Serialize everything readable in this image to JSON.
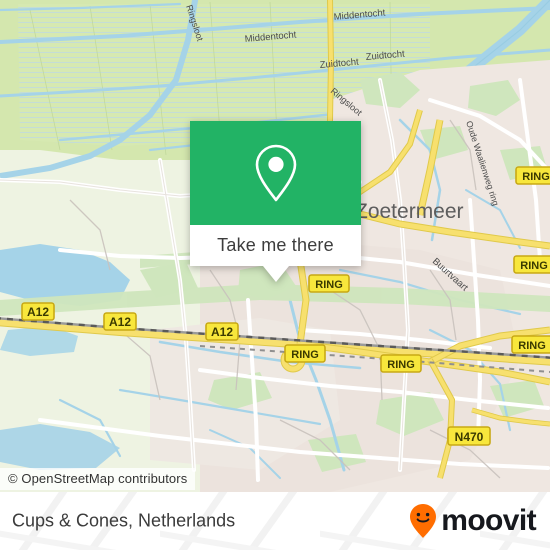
{
  "map": {
    "attribution": "© OpenStreetMap contributors",
    "city_label": "Zoetermeer",
    "water_labels": [
      {
        "name": "Middentocht"
      },
      {
        "name": "Middentocht"
      },
      {
        "name": "Zuidtocht"
      },
      {
        "name": "Zuidtocht"
      },
      {
        "name": "Ringsloot"
      },
      {
        "name": "Ringsloot"
      },
      {
        "name": "Buurtvaart"
      }
    ],
    "street_label": "Oude Waalienweg ring",
    "road_shields": [
      {
        "label": "A12"
      },
      {
        "label": "A12"
      },
      {
        "label": "A12"
      },
      {
        "label": "RING"
      },
      {
        "label": "RING"
      },
      {
        "label": "RING"
      },
      {
        "label": "RING"
      },
      {
        "label": "RING"
      },
      {
        "label": "RING"
      },
      {
        "label": "N470"
      }
    ],
    "colors": {
      "farmland": "#cfe3a8",
      "meadow": "#d6e8b0",
      "residential": "#ece3dd",
      "park": "#c9e4bb",
      "water": "#a5d3e8",
      "road_major": "#f7e06e",
      "road_minor": "#ffffff",
      "shield_fill": "#f8e73c",
      "shield_border": "#c8a915",
      "shield_text": "#3a3a00"
    }
  },
  "popup": {
    "pin_icon": "map-pin-icon",
    "action_label": "Take me there",
    "header_color": "#22b365"
  },
  "footer": {
    "place_title": "Cups & Cones, Netherlands",
    "brand_name": "moovit",
    "brand_icon": "moovit-smiling-pin-icon",
    "brand_icon_color": "#ff6d00",
    "brand_text_color": "#16181d"
  }
}
